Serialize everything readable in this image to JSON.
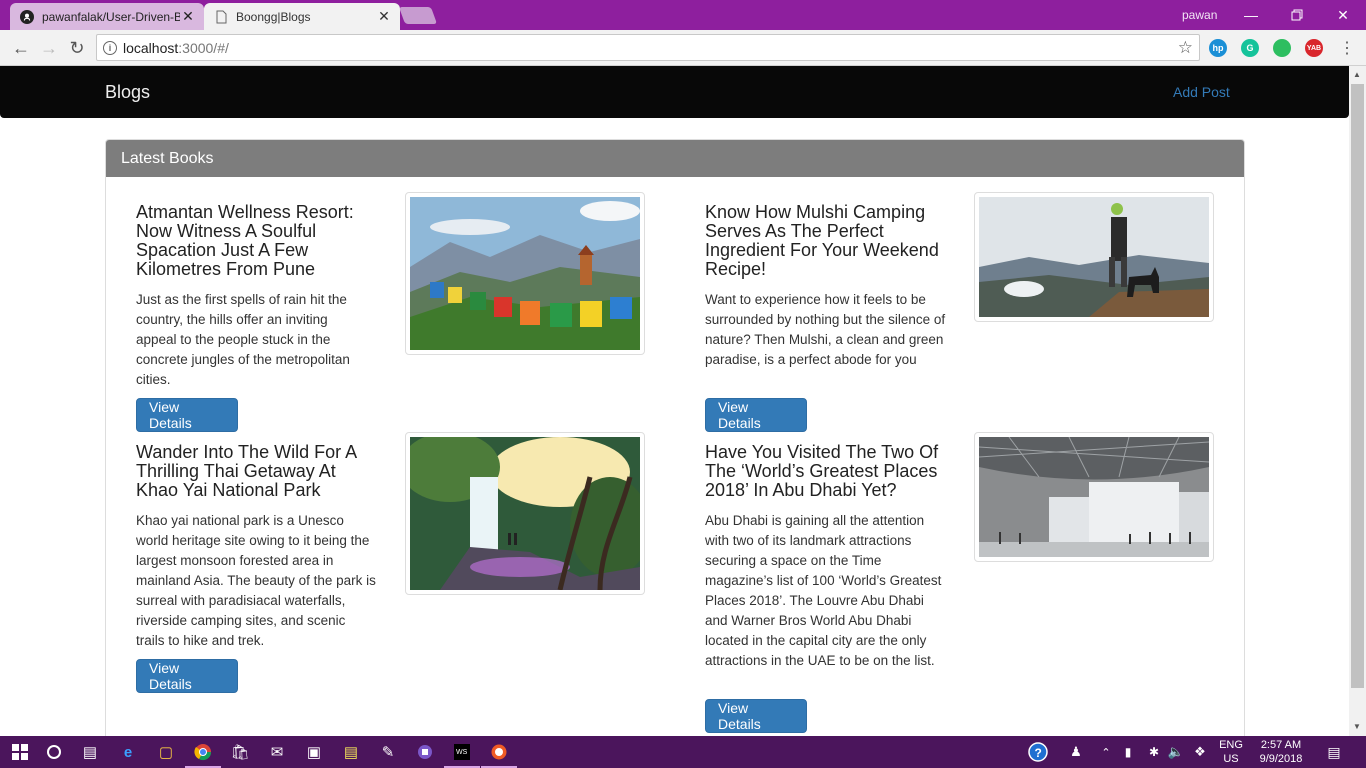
{
  "browser": {
    "tabs": [
      {
        "title": "pawanfalak/User-Driven-B",
        "icon": "github-icon"
      },
      {
        "title": "Boongg|Blogs",
        "icon": "page-icon",
        "close": "✕"
      }
    ],
    "profile": "pawan",
    "url_host": "localhost",
    "url_path": ":3000/#/",
    "extensions": [
      {
        "name": "hp-extension-icon",
        "color": "#1a8fd6",
        "label": "hp"
      },
      {
        "name": "grammarly-icon",
        "color": "#15c39a",
        "label": "G"
      },
      {
        "name": "evernote-icon",
        "color": "#2dbe60",
        "label": ""
      },
      {
        "name": "yab-extension-icon",
        "color": "#d9262c",
        "label": "YAB"
      }
    ]
  },
  "site": {
    "brand": "Blogs",
    "add_post": "Add Post",
    "panel_title": "Latest Books",
    "posts": [
      {
        "title": "Atmantan Wellness Resort: Now Witness A Soulful Spacation Just A Few Kilometres From Pune",
        "text": "Just as the first spells of rain hit the country, the hills offer an inviting appeal to the people stuck in the concrete jungles of the metropolitan cities.",
        "button": "View Details",
        "image": "mountain-prayer-flags-image"
      },
      {
        "title": "Know How Mulshi Camping Serves As The Perfect Ingredient For Your Weekend Recipe!",
        "text": "Want to experience how it feels to be surrounded by nothing but the silence of nature? Then Mulshi, a clean and green paradise, is a perfect abode for you",
        "button": "View Details",
        "image": "hiker-with-dog-image"
      },
      {
        "title": "Wander Into The Wild For A Thrilling Thai Getaway At Khao Yai National Park",
        "text": "Khao yai national park is a Unesco world heritage site owing to it being the largest monsoon forested area in mainland Asia. The beauty of the park is surreal with paradisiacal waterfalls, riverside camping sites, and scenic trails to hike and trek.",
        "button": "View Details",
        "image": "waterfall-forest-image"
      },
      {
        "title": "Have You Visited The Two Of The ‘World’s Greatest Places 2018’ In Abu Dhabi Yet?",
        "text": "Abu Dhabi is gaining all the attention with two of its landmark attractions securing a space on the Time magazine’s list of 100 ‘World’s Greatest Places 2018’. The Louvre Abu Dhabi and Warner Bros World Abu Dhabi located in the capital city are the only attractions in the UAE to be on the list.",
        "button": "View Details",
        "image": "louvre-abu-dhabi-image"
      }
    ]
  },
  "taskbar": {
    "language": "ENG",
    "region": "US",
    "time": "2:57 AM",
    "date": "9/9/2018"
  },
  "colors": {
    "title_bar": "#8e1f9e",
    "taskbar": "#4b155c",
    "navbar": "#080808",
    "panel_heading": "#7d7d7d",
    "button": "#337ab7"
  }
}
